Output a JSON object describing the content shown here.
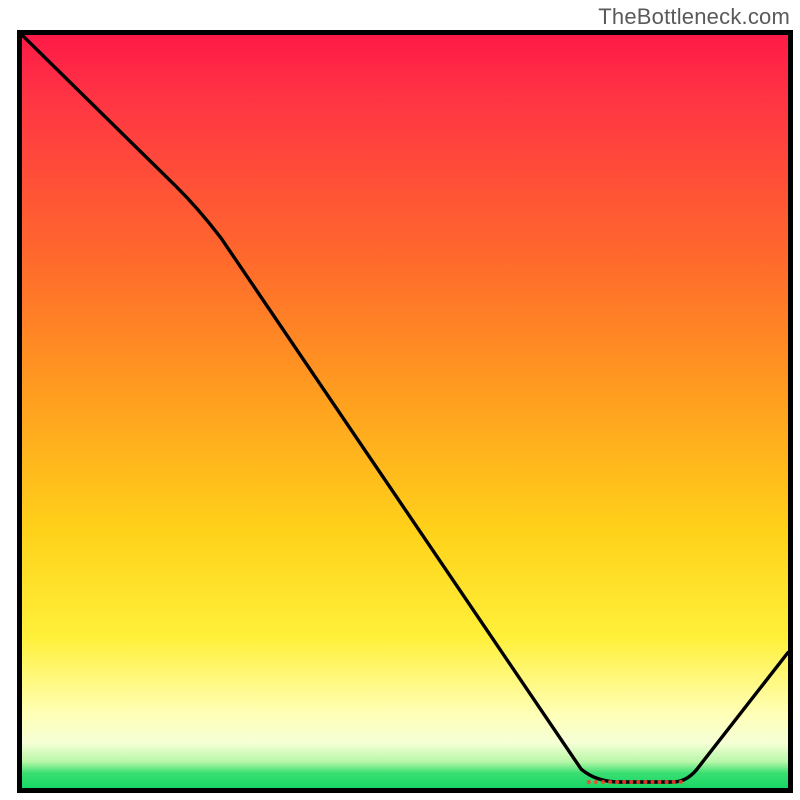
{
  "watermark": "TheBottleneck.com",
  "colors": {
    "curve": "#000000",
    "marker": "#ff3d2e",
    "frame": "#000000"
  },
  "chart_data": {
    "type": "line",
    "title": "",
    "xlabel": "",
    "ylabel": "",
    "xlim": [
      0,
      100
    ],
    "ylim": [
      0,
      100
    ],
    "grid": false,
    "legend": false,
    "series": [
      {
        "name": "bottleneck-curve",
        "x": [
          0,
          22,
          75,
          85,
          100
        ],
        "y": [
          100,
          78,
          1,
          1,
          18
        ]
      }
    ],
    "optimum_band": {
      "x_start": 74,
      "x_end": 86,
      "y": 0.8
    },
    "marker_label": ""
  }
}
